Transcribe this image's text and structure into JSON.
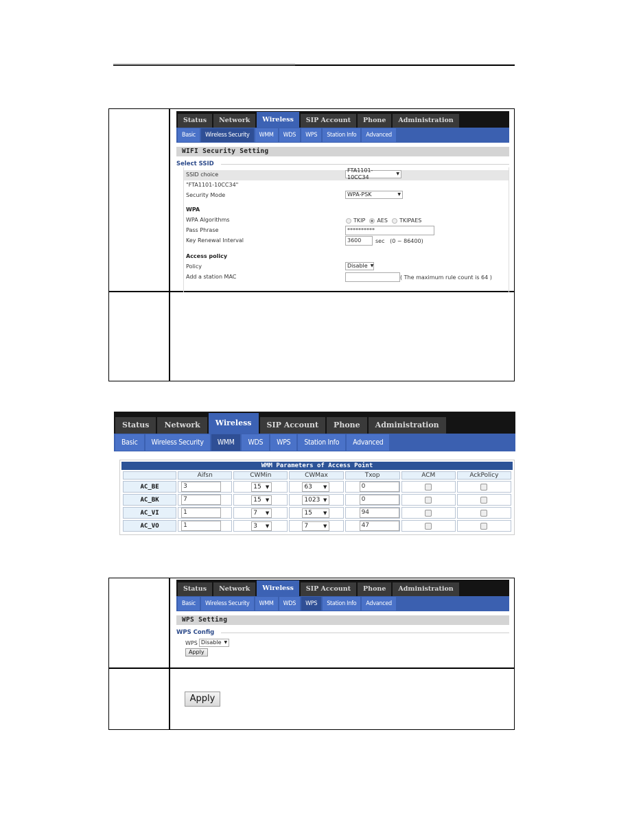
{
  "main_tabs": [
    "Status",
    "Network",
    "Wireless",
    "SIP Account",
    "Phone",
    "Administration"
  ],
  "sub_tabs": [
    "Basic",
    "Wireless Security",
    "WMM",
    "WDS",
    "WPS",
    "Station Info",
    "Advanced"
  ],
  "security": {
    "section_title": "WIFI Security Setting",
    "legend": "Select SSID",
    "ssid_choice_label": "SSID choice",
    "ssid_choice_value": "FTA1101-10CC34",
    "ssid_quoted": "\"FTA1101-10CC34\"",
    "security_mode_label": "Security Mode",
    "security_mode_value": "WPA-PSK",
    "wpa_heading": "WPA",
    "wpa_algorithms_label": "WPA Algorithms",
    "algorithms": [
      "TKIP",
      "AES",
      "TKIPAES"
    ],
    "algorithm_selected": "AES",
    "pass_phrase_label": "Pass Phrase",
    "pass_phrase_value": "**********",
    "key_renewal_label": "Key Renewal Interval",
    "key_renewal_value": "3600",
    "key_renewal_hint": "sec   (0 ~ 86400)",
    "access_policy_heading": "Access policy",
    "policy_label": "Policy",
    "policy_value": "Disable",
    "add_mac_label": "Add a station MAC",
    "add_mac_value": "",
    "add_mac_hint": "( The maximum rule count is 64 )"
  },
  "wmm": {
    "title": "WMM Parameters of Access Point",
    "columns": [
      "",
      "Aifsn",
      "CWMin",
      "CWMax",
      "Txop",
      "ACM",
      "AckPolicy"
    ],
    "rows": [
      {
        "name": "AC_BE",
        "aifsn": "3",
        "cwmin": "15",
        "cwmax": "63",
        "txop": "0",
        "acm": false,
        "ackpolicy": false
      },
      {
        "name": "AC_BK",
        "aifsn": "7",
        "cwmin": "15",
        "cwmax": "1023",
        "txop": "0",
        "acm": false,
        "ackpolicy": false
      },
      {
        "name": "AC_VI",
        "aifsn": "1",
        "cwmin": "7",
        "cwmax": "15",
        "txop": "94",
        "acm": false,
        "ackpolicy": false
      },
      {
        "name": "AC_VO",
        "aifsn": "1",
        "cwmin": "3",
        "cwmax": "7",
        "txop": "47",
        "acm": false,
        "ackpolicy": false
      }
    ]
  },
  "wps": {
    "section_title": "WPS Setting",
    "legend": "WPS Config",
    "wps_label": "WPS",
    "wps_value": "Disable",
    "apply_label": "Apply",
    "large_apply_label": "Apply"
  }
}
